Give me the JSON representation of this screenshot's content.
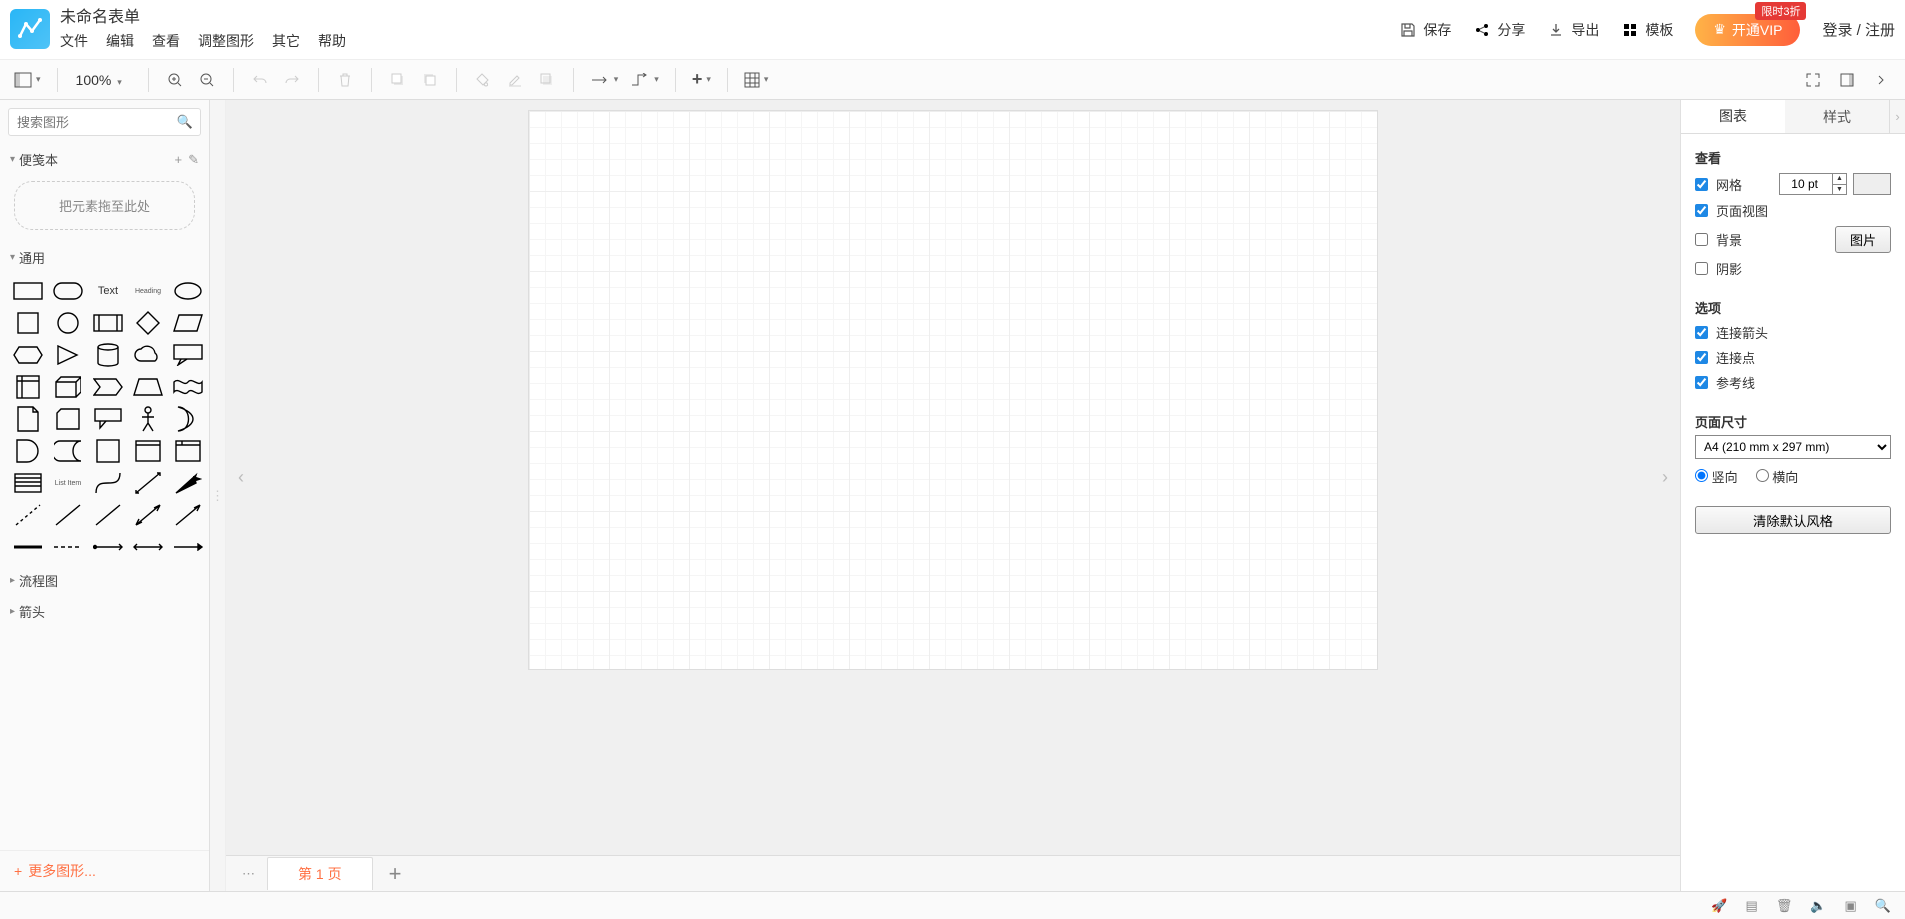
{
  "doc_title": "未命名表单",
  "menubar": [
    "文件",
    "编辑",
    "查看",
    "调整图形",
    "其它",
    "帮助"
  ],
  "header_actions": {
    "save": "保存",
    "share": "分享",
    "export": "导出",
    "template": "模板",
    "vip": "开通VIP",
    "vip_badge": "限时3折",
    "login": "登录 / 注册"
  },
  "toolbar": {
    "zoom": "100%"
  },
  "left": {
    "search_placeholder": "搜索图形",
    "notepad": "便笺本",
    "dropzone": "把元素拖至此处",
    "general": "通用",
    "flowchart": "流程图",
    "arrow": "箭头",
    "more": "更多图形...",
    "text_label": "Text",
    "heading_label": "Heading",
    "listitem_label": "List Item"
  },
  "page_tabs": {
    "page1": "第 1 页"
  },
  "right": {
    "tab_diagram": "图表",
    "tab_style": "样式",
    "view_title": "查看",
    "grid_label": "网格",
    "grid_value": "10 pt",
    "pageview_label": "页面视图",
    "background_label": "背景",
    "image_btn": "图片",
    "shadow_label": "阴影",
    "options_title": "选项",
    "conn_arrow": "连接箭头",
    "conn_point": "连接点",
    "guides": "参考线",
    "pagesize_title": "页面尺寸",
    "pagesize_value": "A4 (210 mm x 297 mm)",
    "orient_portrait": "竖向",
    "orient_landscape": "横向",
    "clear_default": "清除默认风格"
  }
}
